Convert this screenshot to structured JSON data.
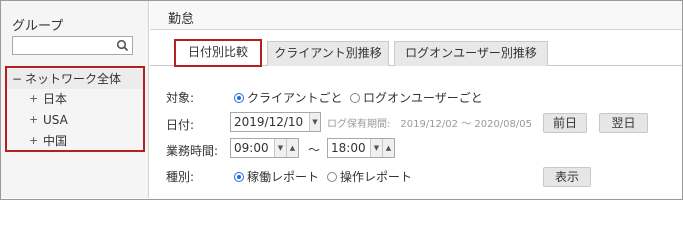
{
  "sidebar": {
    "title": "グループ",
    "search": {
      "value": "",
      "placeholder": ""
    },
    "tree": {
      "root": {
        "toggle": "−",
        "label": "ネットワーク全体"
      },
      "children": [
        {
          "toggle": "+",
          "label": "日本"
        },
        {
          "toggle": "+",
          "label": "USA"
        },
        {
          "toggle": "+",
          "label": "中国"
        }
      ]
    }
  },
  "main": {
    "title": "勤怠",
    "tabs": [
      {
        "label": "日付別比較",
        "active": true
      },
      {
        "label": "クライアント別推移",
        "active": false
      },
      {
        "label": "ログオンユーザー別推移",
        "active": false
      }
    ],
    "form": {
      "target": {
        "label": "対象:",
        "options": [
          {
            "label": "クライアントごと",
            "checked": true
          },
          {
            "label": "ログオンユーザーごと",
            "checked": false
          }
        ]
      },
      "date": {
        "label": "日付:",
        "value": "2019/12/10",
        "retention_hint": "ログ保有期間:　2019/12/02 ～ 2020/08/05",
        "prev_button": "前日",
        "next_button": "翌日"
      },
      "hours": {
        "label": "業務時間:",
        "start": "09:00",
        "separator": "～",
        "end": "18:00"
      },
      "kind": {
        "label": "種別:",
        "options": [
          {
            "label": "稼働レポート",
            "checked": true
          },
          {
            "label": "操作レポート",
            "checked": false
          }
        ],
        "show_button": "表示"
      }
    }
  },
  "colors": {
    "highlight_border": "#b32020",
    "radio_accent": "#1e6fd9"
  }
}
